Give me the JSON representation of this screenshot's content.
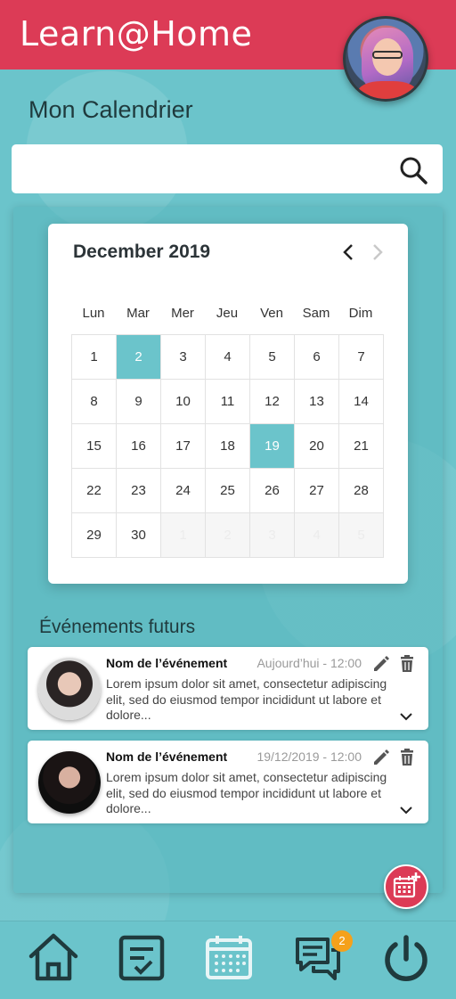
{
  "app": {
    "title": "Learn@Home"
  },
  "page": {
    "title": "Mon Calendrier"
  },
  "search": {
    "value": "",
    "placeholder": ""
  },
  "calendar": {
    "month_label": "December 2019",
    "weekdays": [
      "Lun",
      "Mar",
      "Mer",
      "Jeu",
      "Ven",
      "Sam",
      "Dim"
    ],
    "days": [
      "1",
      "2",
      "3",
      "4",
      "5",
      "6",
      "7",
      "8",
      "9",
      "10",
      "11",
      "12",
      "13",
      "14",
      "15",
      "16",
      "17",
      "18",
      "19",
      "20",
      "21",
      "22",
      "23",
      "24",
      "25",
      "26",
      "27",
      "28",
      "29",
      "30"
    ],
    "trailing_days": [
      "1",
      "2",
      "3",
      "4",
      "5"
    ],
    "selected_days": [
      "2",
      "19"
    ]
  },
  "events": {
    "title": "Événements futurs",
    "items": [
      {
        "name": "Nom de l’événement",
        "date": "Aujourd’hui - 12:00",
        "description": "Lorem ipsum dolor sit amet, consectetur adipiscing elit, sed do eiusmod tempor incididunt ut labore et dolore..."
      },
      {
        "name": "Nom de l’événement",
        "date": "19/12/2019 - 12:00",
        "description": "Lorem ipsum dolor sit amet, consectetur adipiscing elit, sed do eiusmod tempor incididunt ut labore et dolore..."
      }
    ]
  },
  "nav": {
    "items": [
      "home-icon",
      "tasks-icon",
      "calendar-icon",
      "chat-icon",
      "power-icon"
    ],
    "chat_badge": "2"
  },
  "colors": {
    "brand": "#dc3b56",
    "accent": "#6bc4cb",
    "badge": "#f5a11b"
  }
}
